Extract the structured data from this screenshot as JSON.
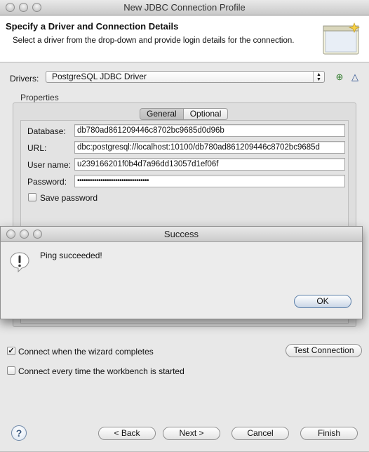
{
  "window": {
    "title": "New JDBC Connection Profile"
  },
  "header": {
    "title": "Specify a Driver and Connection Details",
    "description": "Select a driver from the drop-down and provide login details for the connection."
  },
  "drivers": {
    "label": "Drivers:",
    "selected": "PostgreSQL JDBC Driver",
    "new_driver_icon": "new-driver-icon",
    "edit_driver_icon": "edit-driver-icon"
  },
  "properties": {
    "label": "Properties",
    "tabs": [
      "General",
      "Optional"
    ],
    "active_tab": "General",
    "fields": {
      "database_label": "Database:",
      "database_value": "db780ad861209446c8702bc9685d0d96b",
      "url_label": "URL:",
      "url_value": "dbc:postgresql://localhost:10100/db780ad861209446c8702bc9685d",
      "user_label": "User name:",
      "user_value": "u239166201f0b4d7a96dd13057d1ef06f",
      "password_label": "Password:",
      "password_value": "••••••••••••••••••••••••••••••••••"
    },
    "save_password_label": "Save password",
    "save_password_checked": false
  },
  "options": {
    "connect_on_finish_label": "Connect when the wizard completes",
    "connect_on_finish_checked": true,
    "connect_on_start_label": "Connect every time the workbench is started",
    "connect_on_start_checked": false,
    "test_connection_label": "Test Connection"
  },
  "footer": {
    "help_icon": "help-icon",
    "back_label": "< Back",
    "next_label": "Next >",
    "cancel_label": "Cancel",
    "finish_label": "Finish"
  },
  "dialog": {
    "title": "Success",
    "icon": "warning-exclamation-icon",
    "message": "Ping succeeded!",
    "ok_label": "OK"
  },
  "colors": {
    "window_bg": "#e8e8e8",
    "header_bg": "#ffffff",
    "default_button": "#c9d6e6"
  }
}
